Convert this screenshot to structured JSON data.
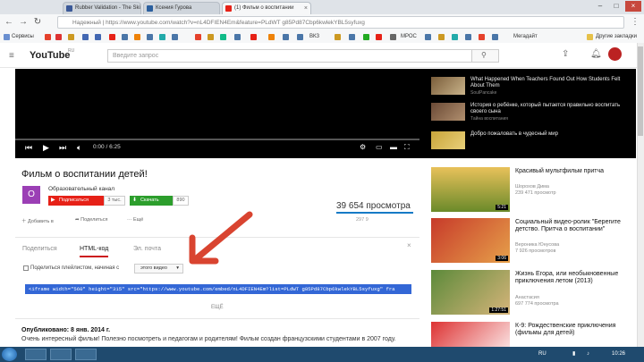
{
  "browser": {
    "tabs": [
      {
        "label": "Rubber Validation - The Ski",
        "icon_color": "#3b5998"
      },
      {
        "label": "Ксения Гурова",
        "icon_color": "#2b5f9e"
      },
      {
        "label": "(1) Фильм о воспитании",
        "icon_color": "#e62117"
      }
    ],
    "address": "Надежный | https://www.youtube.com/watch?v=nL4DFIEN4Em&feature=PLdWT g85Pd87Cbp6kwlekYBL5syfuxg",
    "bookmarks": [
      "Сервисы",
      "ВКЗ",
      "МРОС",
      "Мегадайт",
      "Другие закладки"
    ]
  },
  "youtube": {
    "logo": "YouTube",
    "country": "RU",
    "search_placeholder": "Введите запрос",
    "player_time": "0:00 / 6:25",
    "end_screen": [
      {
        "title": "What Happened When Teachers Found Out How Students Felt About Them",
        "sub": "SoulPancake"
      },
      {
        "title": "История о ребёнке, который пытается правильно воспитать своего сына",
        "sub": "Тайна воспитания"
      },
      {
        "title": "Добро пожаловать в чудесный мир",
        "sub": ""
      }
    ],
    "video": {
      "title": "Фильм о воспитании детей!",
      "avatar_letter": "О",
      "channel": "Образовательный канал",
      "subscribe_label": "Подписаться",
      "subscribe_count": "3 тыс.",
      "download_label": "Скачать",
      "download_count": "890",
      "views": "39 654 просмотра",
      "actions": [
        "Добавить в",
        "Поделиться",
        "Ещё"
      ],
      "likes": "297   9"
    },
    "share": {
      "tabs": [
        "Поделиться",
        "HTML-код",
        "Эл. почта"
      ],
      "active_tab": 1,
      "close": "×",
      "start_label": "Поделиться плейлистом, начиная с",
      "start_select": "этого видео",
      "embed_code": "<iframe width=\"560\" height=\"315\" src=\"https://www.youtube.com/embed/nL4DFIEN4Em?list=PLdWT g85Pd87Cbp6kwlekYBL5syfuxg\" fra",
      "more": "ЕЩЁ"
    },
    "description": {
      "published": "Опубликовано: 8 янв. 2014 г.",
      "text": "Очень интересный фильм! Полезно посмотреть и педагогам и родителям! Фильм создан французскими студентами в 2007 году."
    },
    "related": [
      {
        "title": "Красивый мультфильм притча",
        "channel": "Шорохов Дима",
        "views": "239 471 просмотр",
        "duration": "5:21"
      },
      {
        "title": "Социальный видео-ролик \"Берегите детство. Притча о воспитании\"",
        "channel": "Вероника Юнусова",
        "views": "7 926 просмотров",
        "duration": "3:06"
      },
      {
        "title": "Жизнь Егора, или необыкновенные приключения летом (2013)",
        "channel": "Анастасия",
        "views": "697 774 просмотра",
        "duration": "1:27:51"
      },
      {
        "title": "К-9: Рождественские приключения (фильмы для детей)",
        "channel": "",
        "views": "",
        "duration": ""
      }
    ]
  },
  "taskbar": {
    "clock": "10:26",
    "lang": "RU"
  },
  "colors": {
    "youtube_red": "#e62117",
    "selection_blue": "#3367d6",
    "arrow": "#d94430"
  }
}
